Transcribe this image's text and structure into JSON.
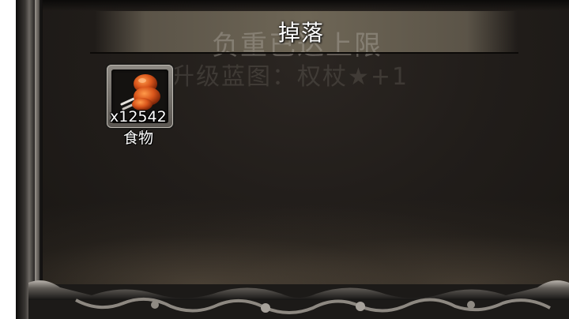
{
  "window": {
    "title": "掉落"
  },
  "background_notices": {
    "line_1": "负重已达上限",
    "line_2": "升级蓝图：权杖★+1"
  },
  "drop_items": [
    {
      "name": "食物",
      "count_label": "x12542",
      "icon": "roast-meat-icon"
    }
  ],
  "colors": {
    "panel_bg": "#211d1a",
    "header_band": "#6e6656",
    "text": "#ffffff"
  }
}
